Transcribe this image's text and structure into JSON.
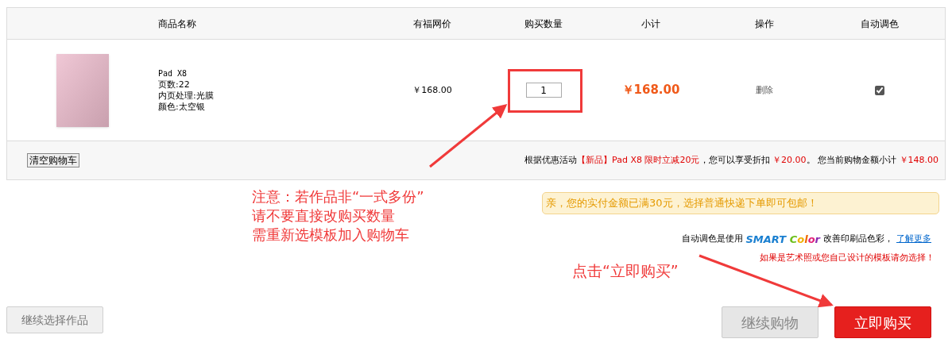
{
  "columns": [
    "商品名称",
    "有福网价",
    "购买数量",
    "小计",
    "操作",
    "自动调色"
  ],
  "item": {
    "name": "Pad X8",
    "attributes": [
      "页数:22",
      "内页处理:光膜",
      "颜色:太空银"
    ],
    "price": "￥168.00",
    "quantity": "1",
    "subtotal": "￥168.00",
    "action": "删除",
    "auto_color": {
      "checked": true
    }
  },
  "clear_cart_button": "清空购物车",
  "promo": [
    {
      "text": "根据优惠活动",
      "highlight": false
    },
    {
      "text": "【新品】Pad X8 限时立减20元",
      "highlight": true
    },
    {
      "text": "，您可以享受折扣 ",
      "highlight": false
    },
    {
      "text": "￥20.00",
      "highlight": true
    },
    {
      "text": "。 您当前购物金额小计 ",
      "highlight": false
    },
    {
      "text": "￥148.00",
      "highlight": true
    }
  ],
  "shipping_notice": "亲，您的实付金额已满30元，选择普通快递下单即可包邮！",
  "smart_color": {
    "prefix": "自动调色是使用",
    "brand_first": "SMART",
    "brand_second": "Color",
    "suffix": "改善印刷品色彩，",
    "link": "了解更多"
  },
  "warning": "如果是艺术照或您自己设计的模板请勿选择！",
  "buttons": {
    "continue_select": "继续选择作品",
    "continue_shopping": "继续购物",
    "buy_now": "立即购买"
  },
  "annotations": {
    "note_lines": [
      "注意：若作品非“一式多份”",
      "请不要直接改购买数量",
      "需重新选模板加入购物车"
    ],
    "callout": "点击“立即购买”"
  }
}
